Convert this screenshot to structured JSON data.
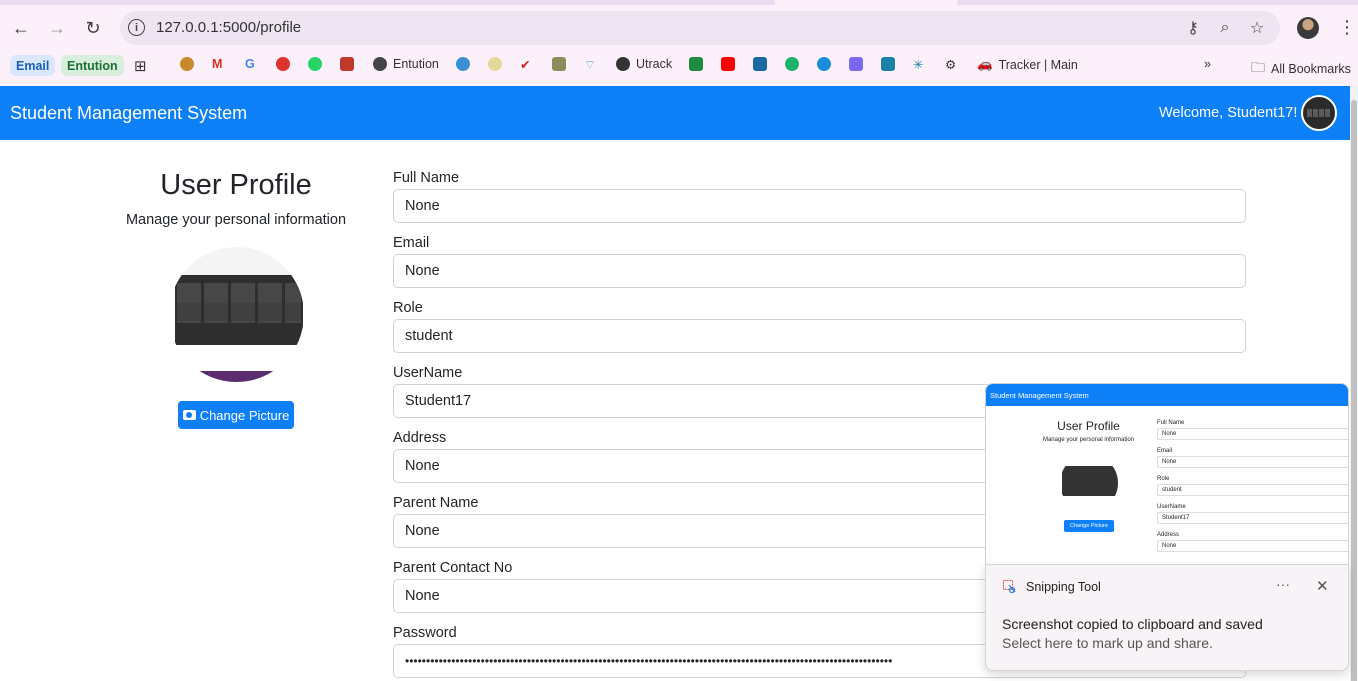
{
  "browser": {
    "url": "127.0.0.1:5000/profile",
    "bookmarks": {
      "chip_email": "Email",
      "chip_entution": "Entution",
      "entution": "Entution",
      "utrack": "Utrack",
      "tracker": "Tracker | Main",
      "all_bookmarks": "All Bookmarks"
    }
  },
  "navbar": {
    "brand": "Student Management System",
    "welcome": "Welcome, Student17!"
  },
  "profile": {
    "title": "User Profile",
    "subtitle": "Manage your personal information",
    "change_picture": "Change Picture"
  },
  "form": {
    "fields": [
      {
        "label": "Full Name",
        "value": "None"
      },
      {
        "label": "Email",
        "value": "None"
      },
      {
        "label": "Role",
        "value": "student"
      },
      {
        "label": "UserName",
        "value": "Student17"
      },
      {
        "label": "Address",
        "value": "None"
      },
      {
        "label": "Parent Name",
        "value": "None"
      },
      {
        "label": "Parent Contact No",
        "value": "None"
      },
      {
        "label": "Password",
        "value": "••••••••••••••••••••••••••••••••••••••••••••••••••••••••••••••••••••••••••••••••••••••••••••••••••••••••••••••••••••"
      }
    ]
  },
  "snip_preview": {
    "nav": "Student Management System",
    "title": "User Profile",
    "subtitle": "Manage your personal information",
    "button": "Change Picture",
    "fields": [
      {
        "label": "Full Name",
        "value": "None"
      },
      {
        "label": "Email",
        "value": "None"
      },
      {
        "label": "Role",
        "value": "student"
      },
      {
        "label": "UserName",
        "value": "Student17"
      },
      {
        "label": "Address",
        "value": "None"
      }
    ]
  },
  "toast": {
    "app": "Snipping Tool",
    "message": "Screenshot copied to clipboard and saved",
    "sub": "Select here to mark up and share."
  },
  "colors": {
    "primary": "#0d7ff7",
    "chrome_bg": "#fcf1fb"
  }
}
